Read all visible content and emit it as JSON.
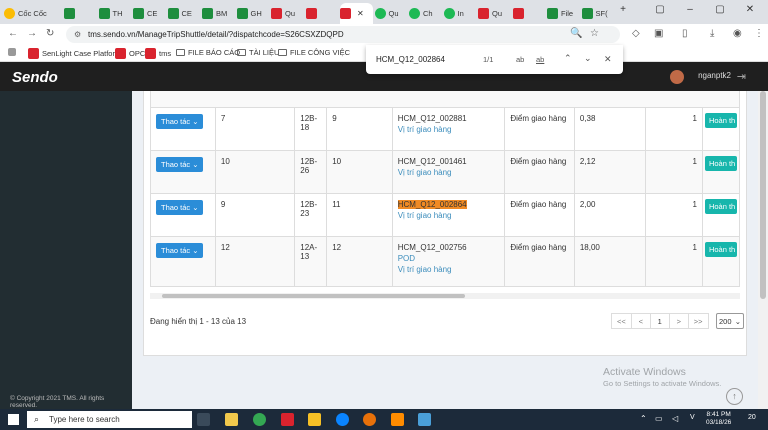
{
  "browser": {
    "brand": "Cốc Cốc",
    "tabs": [
      "",
      "TH",
      "CE",
      "CE",
      "BM",
      "GH",
      "Qu",
      "",
      "",
      "Qu",
      "Ch",
      "In",
      "Qu",
      "",
      "File",
      "SF("
    ],
    "url": "tms.sendo.vn/ManageTripShuttle/detail/?dispatchcode=S26CSXZDQPD",
    "bookmarks": [
      "SenLight Case Platfor...",
      "OPC",
      "tms",
      "FILE BÁO CÁO",
      "TÀI LIỆU",
      "FILE CÔNG VIỆC"
    ]
  },
  "findbar": {
    "query": "HCM_Q12_002864",
    "count": "1/1",
    "opt1": "ab",
    "opt2": "ab"
  },
  "header": {
    "logo": "Sendo",
    "user": "nganptk2"
  },
  "rows": [
    {
      "action": "Thao tác",
      "c1": "7",
      "c2": "12B-18",
      "c3": "9",
      "code": "HCM_Q12_002881",
      "highlight": false,
      "links": [
        "Vị trí giao hàng"
      ],
      "point": "Điểm giao hàng",
      "weight": "0,38",
      "qty": "1",
      "status": "Hoàn th"
    },
    {
      "action": "Thao tác",
      "c1": "10",
      "c2": "12B-26",
      "c3": "10",
      "code": "HCM_Q12_001461",
      "highlight": false,
      "links": [
        "Vị trí giao hàng"
      ],
      "point": "Điểm giao hàng",
      "weight": "2,12",
      "qty": "1",
      "status": "Hoàn th"
    },
    {
      "action": "Thao tác",
      "c1": "9",
      "c2": "12B-23",
      "c3": "11",
      "code": "HCM_Q12_002864",
      "highlight": true,
      "links": [
        "Vị trí giao hàng"
      ],
      "point": "Điểm giao hàng",
      "weight": "2,00",
      "qty": "1",
      "status": "Hoàn th"
    },
    {
      "action": "Thao tác",
      "c1": "12",
      "c2": "12A-13",
      "c3": "12",
      "code": "HCM_Q12_002756",
      "highlight": false,
      "links": [
        "POD",
        "Vị trí giao hàng"
      ],
      "point": "Điểm giao hàng",
      "weight": "18,00",
      "qty": "1",
      "status": "Hoàn th"
    }
  ],
  "footer": {
    "showing": "Đang hiển thị 1 - 13 của 13",
    "pager": [
      "<<",
      "<",
      "1",
      ">",
      ">>"
    ],
    "page_size": "200",
    "activate_title": "Activate Windows",
    "activate_sub": "Go to Settings to activate Windows.",
    "copyright": "© Copyright 2021 TMS. All rights reserved."
  },
  "taskbar": {
    "search": "Type here to search",
    "time": "8:41 PM",
    "date": "03/18/26",
    "notif": "20"
  },
  "colors": {
    "accent": "#2b8dd8",
    "status": "#17b6ac",
    "highlight": "#f08a24",
    "header": "#1f1f1f"
  }
}
